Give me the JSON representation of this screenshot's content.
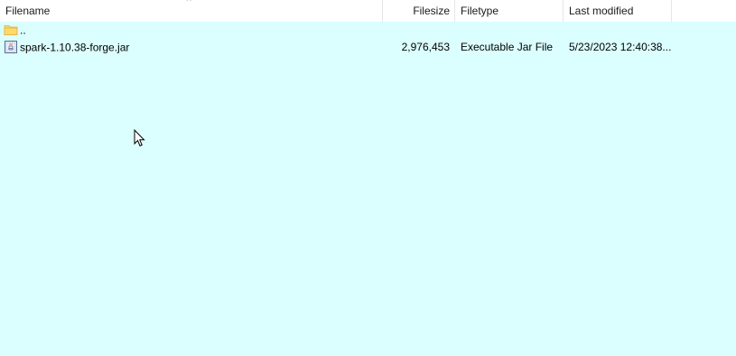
{
  "columns": {
    "filename": "Filename",
    "filesize": "Filesize",
    "filetype": "Filetype",
    "last_modified": "Last modified"
  },
  "sort": {
    "column": "Filename",
    "indicator": "^"
  },
  "rows": [
    {
      "name": "..",
      "size": "",
      "type": "",
      "modified": "",
      "icon": "folder-icon"
    },
    {
      "name": "spark-1.10.38-forge.jar",
      "size": "2,976,453",
      "type": "Executable Jar File",
      "modified": "5/23/2023 12:40:38...",
      "icon": "jar-file-icon"
    }
  ],
  "colors": {
    "list_background": "#dbfefe",
    "header_background": "#ffffff"
  }
}
